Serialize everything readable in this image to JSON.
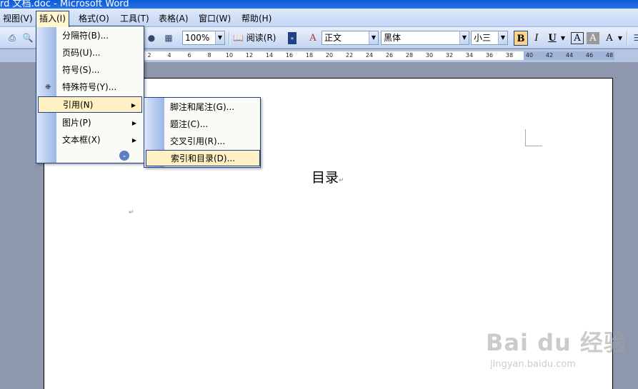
{
  "window": {
    "title": "rd 文档.doc - Microsoft Word"
  },
  "menubar": {
    "items": [
      {
        "label": "视图(V)"
      },
      {
        "label": "插入(I)"
      },
      {
        "label": "格式(O)"
      },
      {
        "label": "工具(T)"
      },
      {
        "label": "表格(A)"
      },
      {
        "label": "窗口(W)"
      },
      {
        "label": "帮助(H)"
      }
    ]
  },
  "toolbar": {
    "zoom": "100%",
    "read_label": "阅读(R)",
    "style": "正文",
    "font": "黑体",
    "font_size": "小三",
    "bold": "B",
    "italic": "I",
    "underline": "U",
    "font_color": "A",
    "char_shading": "A",
    "phonetic": "A"
  },
  "ruler": {
    "ticks": [
      "2",
      "4",
      "6",
      "8",
      "10",
      "12",
      "14",
      "16",
      "18",
      "20",
      "22",
      "24",
      "26",
      "28",
      "30",
      "32",
      "34",
      "36",
      "38",
      "40",
      "42",
      "44",
      "46",
      "48"
    ]
  },
  "insert_menu": {
    "items": [
      {
        "label": "分隔符(B)..."
      },
      {
        "label": "页码(U)..."
      },
      {
        "label": "符号(S)..."
      },
      {
        "label": "特殊符号(Y)..."
      },
      {
        "label": "引用(N)"
      },
      {
        "label": "图片(P)"
      },
      {
        "label": "文本框(X)"
      }
    ]
  },
  "reference_submenu": {
    "items": [
      {
        "label": "脚注和尾注(G)..."
      },
      {
        "label": "题注(C)..."
      },
      {
        "label": "交叉引用(R)..."
      },
      {
        "label": "索引和目录(D)..."
      }
    ]
  },
  "document": {
    "title": "目录",
    "para_mark": "↵"
  },
  "watermark": {
    "logo": "Bai du 经验",
    "url": "jingyan.baidu.com"
  }
}
